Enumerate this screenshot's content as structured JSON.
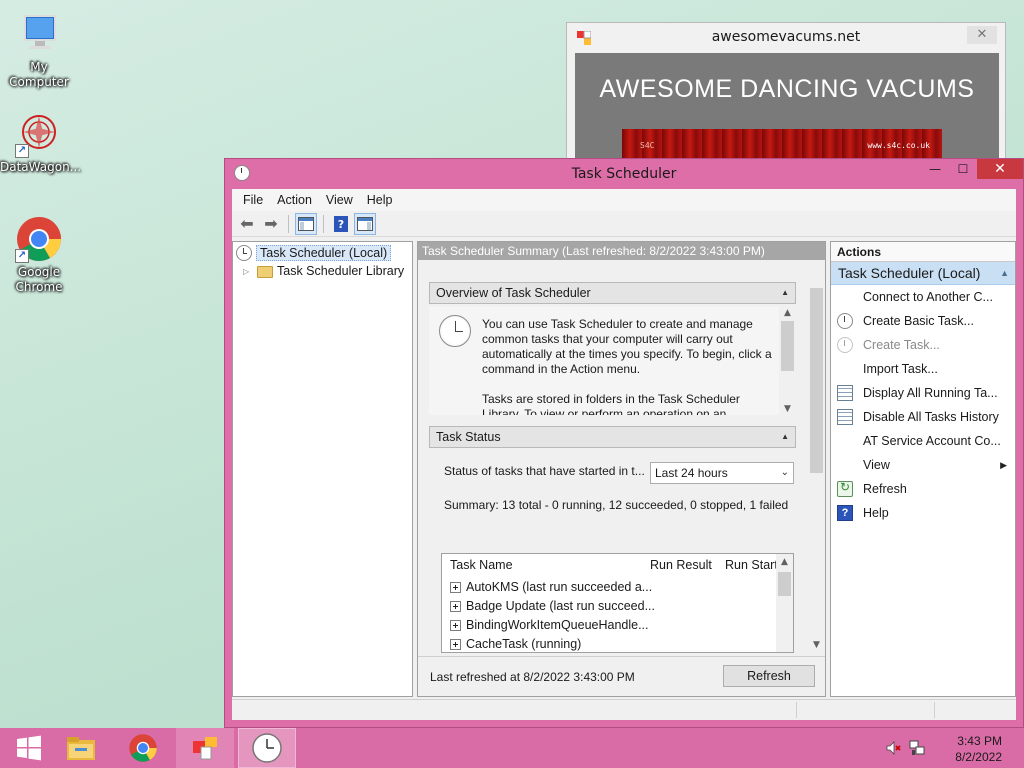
{
  "desktop": {
    "icons": [
      {
        "label": "My Computer",
        "icon": "computer-icon"
      },
      {
        "label": "DataWagon...",
        "icon": "datawagon-icon"
      },
      {
        "label": "Google Chrome",
        "icon": "chrome-icon"
      }
    ]
  },
  "background_window": {
    "title": "awesomevacums.net",
    "close": "✕",
    "banner": "AWESOME DANCING VACUMS",
    "image_tag_left": "S4C",
    "image_tag_right": "www.s4c.co.uk"
  },
  "window": {
    "title": "Task Scheduler",
    "min": "—",
    "max": "☐",
    "close": "✕",
    "menu": [
      "File",
      "Action",
      "View",
      "Help"
    ],
    "tree": {
      "root": "Task Scheduler (Local)",
      "child": "Task Scheduler Library"
    },
    "center": {
      "header": "Task Scheduler Summary (Last refreshed: 8/2/2022 3:43:00 PM)",
      "overview_title": "Overview of Task Scheduler",
      "overview_p1": "You can use Task Scheduler to create and manage common tasks that your computer will carry out automatically at the times you specify. To begin, click a command in the Action menu.",
      "overview_p2": "Tasks are stored in folders in the Task Scheduler Library. To view or perform an operation on an",
      "status_title": "Task Status",
      "status_label": "Status of tasks that have started in t...",
      "status_select": "Last 24 hours",
      "summary": "Summary: 13 total - 0 running, 12 succeeded, 0 stopped, 1 failed",
      "columns": [
        "Task Name",
        "Run Result",
        "Run Start"
      ],
      "tasks": [
        "AutoKMS (last run succeeded a...",
        "Badge Update (last run succeed...",
        "BindingWorkItemQueueHandle...",
        "CacheTask (running)"
      ],
      "last_refreshed": "Last refreshed at 8/2/2022 3:43:00 PM",
      "refresh_button": "Refresh"
    },
    "actions": {
      "header": "Actions",
      "group": "Task Scheduler (Local)",
      "items": [
        {
          "label": "Connect to Another C...",
          "icon": "",
          "disabled": false
        },
        {
          "label": "Create Basic Task...",
          "icon": "clock-icon",
          "disabled": false
        },
        {
          "label": "Create Task...",
          "icon": "clock-icon",
          "disabled": true
        },
        {
          "label": "Import Task...",
          "icon": "",
          "disabled": false
        },
        {
          "label": "Display All Running Ta...",
          "icon": "list-icon",
          "disabled": false
        },
        {
          "label": "Disable All Tasks History",
          "icon": "list-icon",
          "disabled": false
        },
        {
          "label": "AT Service Account Co...",
          "icon": "",
          "disabled": false
        },
        {
          "label": "View",
          "icon": "",
          "disabled": false,
          "submenu": true
        },
        {
          "label": "Refresh",
          "icon": "refresh-icon",
          "disabled": false
        },
        {
          "label": "Help",
          "icon": "help-icon",
          "disabled": false
        }
      ]
    }
  },
  "taskbar": {
    "time": "3:43 PM",
    "date": "8/2/2022"
  },
  "colors": {
    "accent": "#de6ea7",
    "taskbar": "#d96ca6",
    "close_red": "#c7393f",
    "selection": "#c9dff3"
  }
}
